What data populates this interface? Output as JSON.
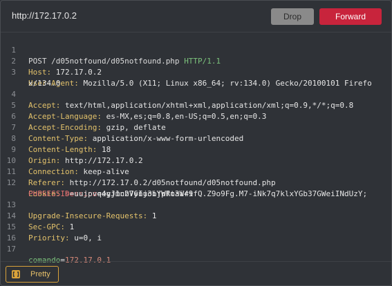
{
  "header": {
    "url": "http://172.17.0.2",
    "drop_label": "Drop",
    "forward_label": "Forward"
  },
  "request": {
    "method": "POST",
    "path": "/d05notfound/d05notfound.php",
    "protocol": "HTTP/1.1",
    "headers": [
      {
        "name": "Host",
        "value": "172.17.0.2"
      },
      {
        "name": "User-Agent",
        "value": "Mozilla/5.0 (X11; Linux x86_64; rv:134.0) Gecko/20100101 Firefo",
        "cont": "x/134.0"
      },
      {
        "name": "Accept",
        "value": "text/html,application/xhtml+xml,application/xml;q=0.9,*/*;q=0.8"
      },
      {
        "name": "Accept-Language",
        "value": "es-MX,es;q=0.8,en-US;q=0.5,en;q=0.3"
      },
      {
        "name": "Accept-Encoding",
        "value": "gzip, deflate"
      },
      {
        "name": "Content-Type",
        "value": "application/x-www-form-urlencoded"
      },
      {
        "name": "Content-Length",
        "value": "18"
      },
      {
        "name": "Origin",
        "value": "http://172.17.0.2"
      },
      {
        "name": "Connection",
        "value": "keep-alive"
      },
      {
        "name": "Referer",
        "value": "http://172.17.0.2/d05notfound/d05notfound.php"
      }
    ],
    "cookie": {
      "name": "Cookie",
      "session_key": "session",
      "session_value": "eyJ1c2VyIjoiYWRtaW4ifQ.Z9o9Fg.M7-iNk7q7klxYGb37GWeiINdUzY;",
      "phpsessid_key": "PHPSESSID",
      "phpsessid_value": "uujpvq4gjmnb76nu3bjpfo3ir9"
    },
    "headers_after": [
      {
        "name": "Upgrade-Insecure-Requests",
        "value": "1"
      },
      {
        "name": "Sec-GPC",
        "value": "1"
      },
      {
        "name": "Priority",
        "value": "u=0, i"
      }
    ],
    "body": {
      "key": "comando",
      "value": "172.17.0.1"
    }
  },
  "line_numbers": [
    "1",
    "2",
    "3",
    "4",
    "5",
    "6",
    "7",
    "8",
    "9",
    "10",
    "11",
    "12",
    "13",
    "14",
    "15",
    "16",
    "17"
  ],
  "footer": {
    "pretty_label": "Pretty"
  },
  "colors": {
    "forward": "#c8243c",
    "drop": "#8a8a8a",
    "header_name": "#e3c26b",
    "protocol": "#7cc27c",
    "cookie_key": "#e07070",
    "pretty_border": "#d9a23a"
  }
}
